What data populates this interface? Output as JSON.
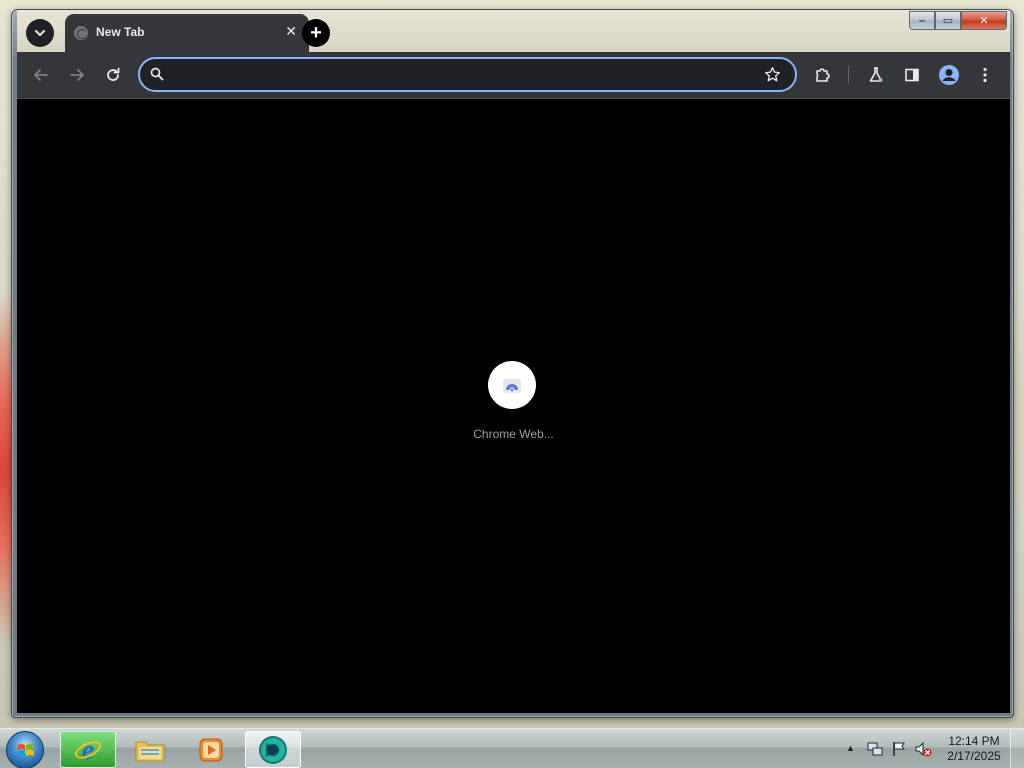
{
  "browser": {
    "tab": {
      "title": "New Tab",
      "close_glyph": "✕"
    },
    "new_tab_glyph": "+",
    "window_controls": {
      "minimize": "–",
      "maximize": "▭",
      "close": "✕"
    },
    "toolbar": {
      "back_icon": "arrow-left-icon",
      "forward_icon": "arrow-right-icon",
      "reload_icon": "reload-icon",
      "omnibox": {
        "value": "",
        "placeholder": ""
      },
      "bookmark_icon": "star-icon",
      "extensions_icon": "puzzle-icon",
      "labs_icon": "flask-icon",
      "side_panel_icon": "side-panel-icon",
      "profile_icon": "avatar-icon",
      "menu_icon": "kebab-menu-icon"
    },
    "content": {
      "loading_label": "Chrome Web..."
    }
  },
  "taskbar": {
    "apps": [
      "Internet Explorer",
      "Windows Explorer",
      "Windows Media Player",
      "Google Chrome"
    ],
    "clock": {
      "time": "12:14 PM",
      "date": "2/17/2025"
    },
    "tray_icons": [
      "network-icon",
      "action-center-flag-icon",
      "volume-muted-icon"
    ]
  },
  "colors": {
    "tab_bg": "#35363a",
    "content_bg": "#000000",
    "omnibox_focus": "#8ab4f8",
    "close_red": "#c1351d"
  }
}
